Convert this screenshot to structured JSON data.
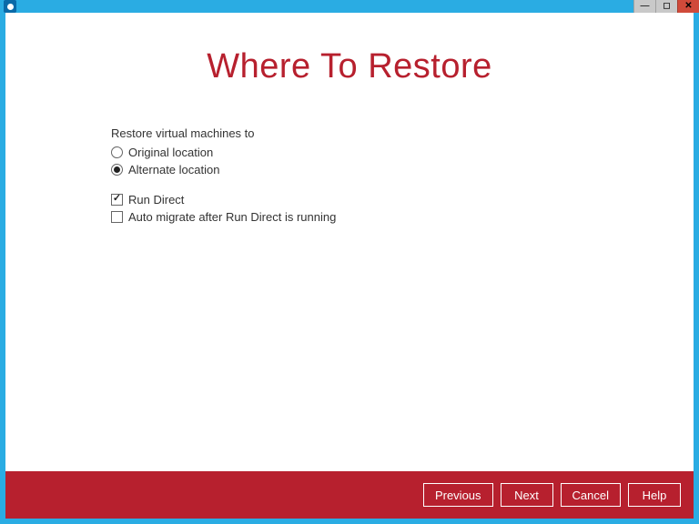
{
  "colors": {
    "frame": "#2aace3",
    "accent": "#b7202e",
    "close": "#d04a3a"
  },
  "page": {
    "title": "Where To Restore"
  },
  "form": {
    "section_label": "Restore virtual machines to",
    "radio_original": {
      "label": "Original location",
      "checked": false
    },
    "radio_alternate": {
      "label": "Alternate location",
      "checked": true
    },
    "check_run_direct": {
      "label": "Run Direct",
      "checked": true
    },
    "check_auto_migrate": {
      "label": "Auto migrate after Run Direct is running",
      "checked": false
    }
  },
  "footer": {
    "previous": "Previous",
    "next": "Next",
    "cancel": "Cancel",
    "help": "Help"
  }
}
